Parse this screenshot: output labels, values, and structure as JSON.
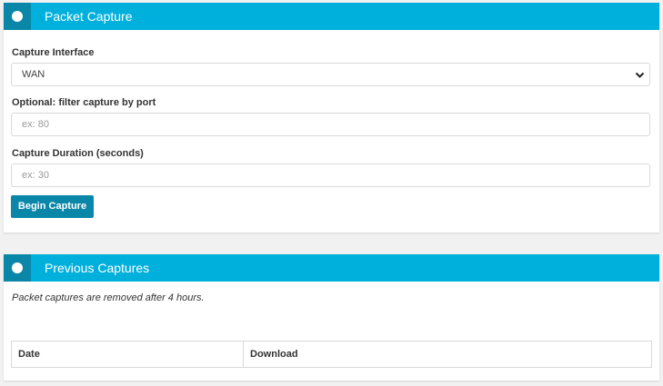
{
  "packet_capture": {
    "title": "Packet Capture",
    "interface_label": "Capture Interface",
    "interface_value": "WAN",
    "port_label": "Optional: filter capture by port",
    "port_placeholder": "ex: 80",
    "duration_label": "Capture Duration (seconds)",
    "duration_placeholder": "ex: 30",
    "begin_button": "Begin Capture"
  },
  "previous_captures": {
    "title": "Previous Captures",
    "note": "Packet captures are removed after 4 hours.",
    "columns": [
      "Date",
      "Download"
    ]
  },
  "colors": {
    "header": "#00b0dc",
    "header_tab": "#0a87a8",
    "button": "#0a87a8"
  }
}
